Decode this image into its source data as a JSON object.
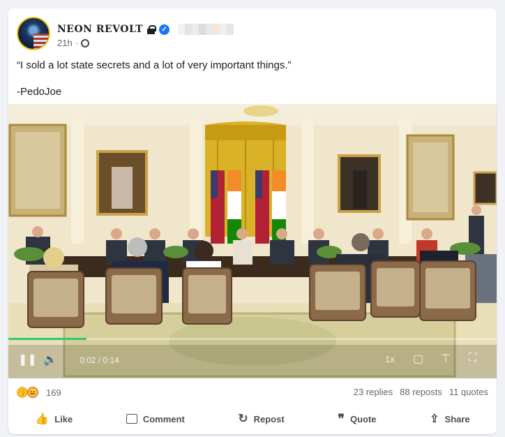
{
  "post": {
    "author": "NEON REVOLT",
    "time": "21h",
    "text_line1": "“I sold a lot state secrets and a lot of very important things.”",
    "text_line2": "-PedoJoe"
  },
  "video": {
    "time_current": "0:02",
    "time_separator": "/",
    "time_total": "0:14",
    "speed": "1x",
    "progress": 0.16
  },
  "stats": {
    "reaction_count": "169",
    "replies": "23 replies",
    "reposts": "88 reposts",
    "quotes": "11 quotes"
  },
  "actions": {
    "like": "Like",
    "comment": "Comment",
    "repost": "Repost",
    "quote": "Quote",
    "share": "Share"
  },
  "colors": {
    "verified": "#1877f2",
    "progress": "#2ecc71",
    "avatar_ring": "#f0c419"
  },
  "icons": [
    "lock-icon",
    "verified-icon",
    "globe-icon",
    "like-icon",
    "comment-icon",
    "repost-icon",
    "quote-icon",
    "share-icon",
    "pause-icon",
    "volume-icon",
    "pip-icon",
    "captions-icon",
    "fullscreen-icon"
  ]
}
